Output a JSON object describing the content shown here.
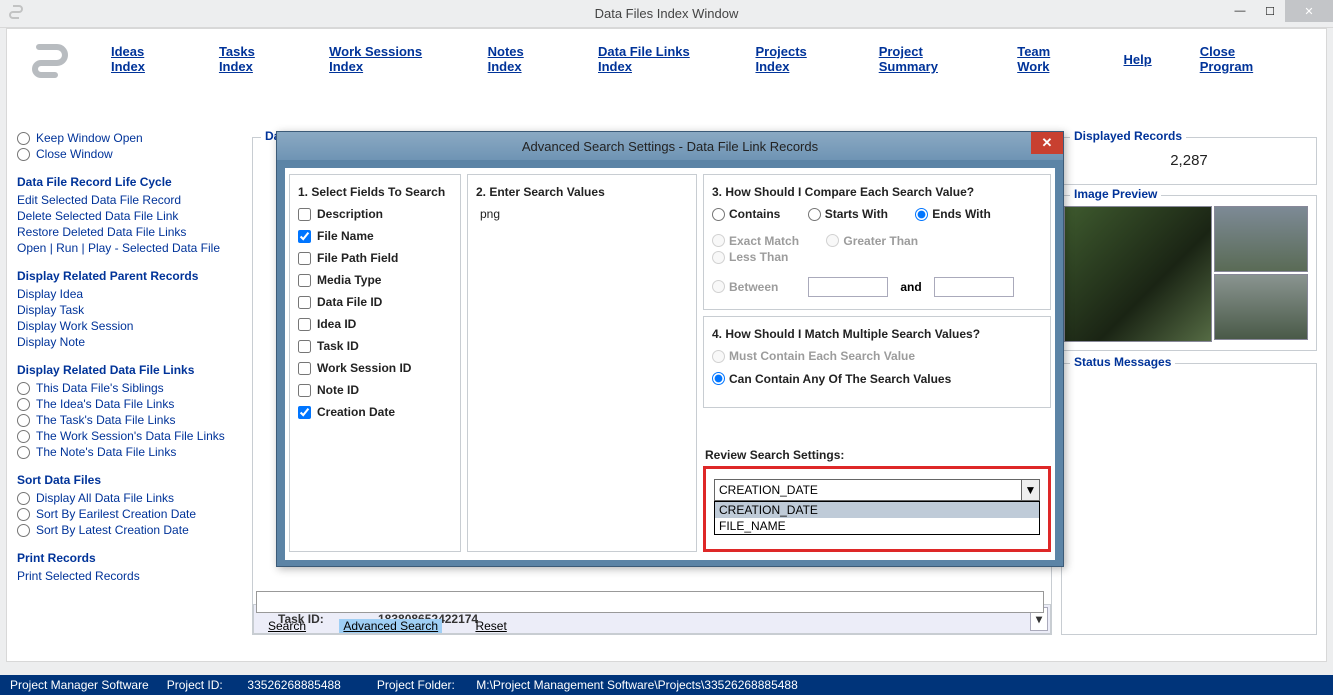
{
  "window": {
    "title": "Data Files Index Window"
  },
  "nav": {
    "items": [
      "Ideas Index",
      "Tasks Index",
      "Work Sessions Index",
      "Notes Index",
      "Data File Links Index",
      "Projects Index",
      "Project Summary",
      "Team Work",
      "Help",
      "Close Program"
    ]
  },
  "sidebar": {
    "keep_open": "Keep Window Open",
    "close_window": "Close Window",
    "lifecycle_title": "Data File Record Life Cycle",
    "lifecycle": [
      "Edit Selected Data File Record",
      "Delete Selected Data File Link",
      "Restore Deleted Data File Links",
      "Open | Run | Play - Selected Data File"
    ],
    "parent_title": "Display Related Parent Records",
    "parent": [
      "Display Idea",
      "Display Task",
      "Display Work Session",
      "Display Note"
    ],
    "links_title": "Display Related Data File Links",
    "links": [
      "This Data File's Siblings",
      "The Idea's Data File Links",
      "The Task's Data File Links",
      "The Work Session's Data File Links",
      "The Note's Data File Links"
    ],
    "sort_title": "Sort Data Files",
    "sort": [
      "Display All Data File Links",
      "Sort By Earilest Creation Date",
      "Sort By Latest Creation Date"
    ],
    "print_title": "Print Records",
    "print": [
      "Print Selected Records"
    ]
  },
  "datafiles": {
    "legend": "Data Files List",
    "task_label": "Task ID:",
    "task_value": "183808652422174",
    "search": "Search",
    "adv_search": "Advanced Search",
    "reset": "Reset"
  },
  "displayed": {
    "legend": "Displayed Records",
    "value": "2,287"
  },
  "preview": {
    "legend": "Image Preview"
  },
  "status": {
    "legend": "Status Messages"
  },
  "dialog": {
    "title": "Advanced Search Settings - Data File Link Records",
    "p1_title": "1. Select Fields To Search",
    "fields": [
      {
        "label": "Description",
        "checked": false
      },
      {
        "label": "File Name",
        "checked": true
      },
      {
        "label": "File Path Field",
        "checked": false
      },
      {
        "label": "Media Type",
        "checked": false
      },
      {
        "label": "Data File ID",
        "checked": false
      },
      {
        "label": "Idea ID",
        "checked": false
      },
      {
        "label": "Task ID",
        "checked": false
      },
      {
        "label": "Work Session ID",
        "checked": false
      },
      {
        "label": "Note ID",
        "checked": false
      },
      {
        "label": "Creation Date",
        "checked": true
      }
    ],
    "p2_title": "2. Enter Search Values",
    "p2_value": "png",
    "p3_title": "3. How Should I Compare Each Search Value?",
    "compare": {
      "contains": "Contains",
      "starts": "Starts With",
      "ends": "Ends With",
      "exact": "Exact Match",
      "greater": "Greater Than",
      "less": "Less Than",
      "between": "Between",
      "and": "and"
    },
    "p4_title": "4. How Should I Match Multiple Search Values?",
    "match": {
      "each": "Must Contain Each Search Value",
      "any": "Can Contain Any Of The Search Values"
    },
    "review_label": "Review Search Settings:",
    "combo_value": "CREATION_DATE",
    "options": [
      "CREATION_DATE",
      "FILE_NAME"
    ]
  },
  "footer": {
    "app": "Project Manager Software",
    "pid_label": "Project ID:",
    "pid": "33526268885488",
    "folder_label": "Project Folder:",
    "folder": "M:\\Project Management Software\\Projects\\33526268885488"
  }
}
